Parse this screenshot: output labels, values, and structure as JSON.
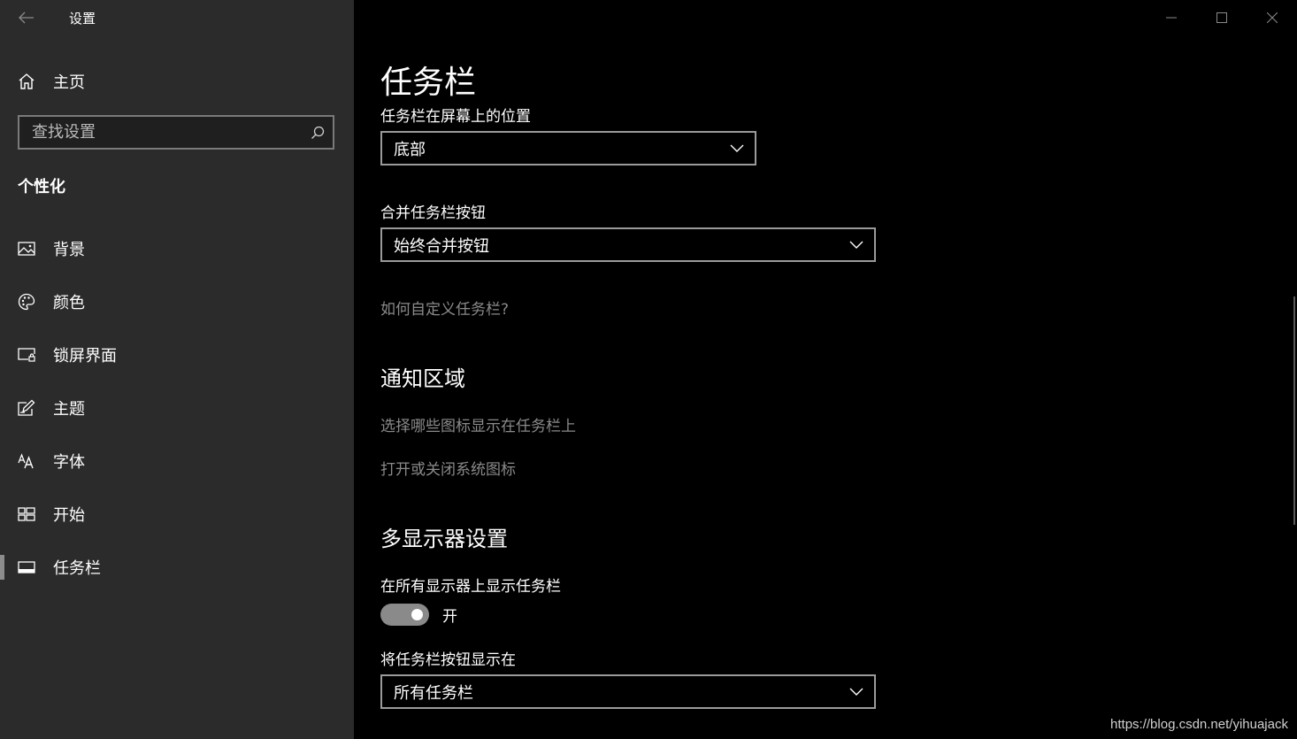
{
  "window": {
    "app_title": "设置"
  },
  "sidebar": {
    "home_label": "主页",
    "search_placeholder": "查找设置",
    "section_heading": "个性化",
    "items": [
      {
        "label": "背景",
        "icon": "picture-icon"
      },
      {
        "label": "颜色",
        "icon": "palette-icon"
      },
      {
        "label": "锁屏界面",
        "icon": "lock-screen-icon"
      },
      {
        "label": "主题",
        "icon": "theme-pen-icon"
      },
      {
        "label": "字体",
        "icon": "font-icon"
      },
      {
        "label": "开始",
        "icon": "start-menu-icon"
      },
      {
        "label": "任务栏",
        "icon": "taskbar-icon",
        "active": true
      }
    ]
  },
  "main": {
    "title": "任务栏",
    "position_label": "任务栏在屏幕上的位置",
    "position_value": "底部",
    "combine_label": "合并任务栏按钮",
    "combine_value": "始终合并按钮",
    "customize_link": "如何自定义任务栏?",
    "notification_heading": "通知区域",
    "notification_link_1": "选择哪些图标显示在任务栏上",
    "notification_link_2": "打开或关闭系统图标",
    "multi_display_heading": "多显示器设置",
    "show_all_label": "在所有显示器上显示任务栏",
    "show_all_state": "开",
    "show_all_on": true,
    "buttons_on_label": "将任务栏按钮显示在",
    "buttons_on_value": "所有任务栏"
  },
  "watermark": "https://blog.csdn.net/yihuajack",
  "colors": {
    "sidebar_bg": "#2b2b2b",
    "main_bg": "#000000",
    "link": "#8a8a8a",
    "toggle": "#8a8a8a"
  }
}
